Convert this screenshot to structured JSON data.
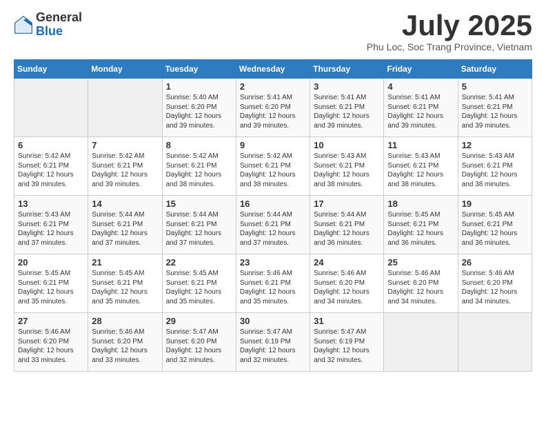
{
  "logo": {
    "general": "General",
    "blue": "Blue"
  },
  "title": {
    "month": "July 2025",
    "location": "Phu Loc, Soc Trang Province, Vietnam"
  },
  "headers": [
    "Sunday",
    "Monday",
    "Tuesday",
    "Wednesday",
    "Thursday",
    "Friday",
    "Saturday"
  ],
  "weeks": [
    [
      {
        "day": "",
        "info": ""
      },
      {
        "day": "",
        "info": ""
      },
      {
        "day": "1",
        "info": "Sunrise: 5:40 AM\nSunset: 6:20 PM\nDaylight: 12 hours and 39 minutes."
      },
      {
        "day": "2",
        "info": "Sunrise: 5:41 AM\nSunset: 6:20 PM\nDaylight: 12 hours and 39 minutes."
      },
      {
        "day": "3",
        "info": "Sunrise: 5:41 AM\nSunset: 6:21 PM\nDaylight: 12 hours and 39 minutes."
      },
      {
        "day": "4",
        "info": "Sunrise: 5:41 AM\nSunset: 6:21 PM\nDaylight: 12 hours and 39 minutes."
      },
      {
        "day": "5",
        "info": "Sunrise: 5:41 AM\nSunset: 6:21 PM\nDaylight: 12 hours and 39 minutes."
      }
    ],
    [
      {
        "day": "6",
        "info": "Sunrise: 5:42 AM\nSunset: 6:21 PM\nDaylight: 12 hours and 39 minutes."
      },
      {
        "day": "7",
        "info": "Sunrise: 5:42 AM\nSunset: 6:21 PM\nDaylight: 12 hours and 39 minutes."
      },
      {
        "day": "8",
        "info": "Sunrise: 5:42 AM\nSunset: 6:21 PM\nDaylight: 12 hours and 38 minutes."
      },
      {
        "day": "9",
        "info": "Sunrise: 5:42 AM\nSunset: 6:21 PM\nDaylight: 12 hours and 38 minutes."
      },
      {
        "day": "10",
        "info": "Sunrise: 5:43 AM\nSunset: 6:21 PM\nDaylight: 12 hours and 38 minutes."
      },
      {
        "day": "11",
        "info": "Sunrise: 5:43 AM\nSunset: 6:21 PM\nDaylight: 12 hours and 38 minutes."
      },
      {
        "day": "12",
        "info": "Sunrise: 5:43 AM\nSunset: 6:21 PM\nDaylight: 12 hours and 38 minutes."
      }
    ],
    [
      {
        "day": "13",
        "info": "Sunrise: 5:43 AM\nSunset: 6:21 PM\nDaylight: 12 hours and 37 minutes."
      },
      {
        "day": "14",
        "info": "Sunrise: 5:44 AM\nSunset: 6:21 PM\nDaylight: 12 hours and 37 minutes."
      },
      {
        "day": "15",
        "info": "Sunrise: 5:44 AM\nSunset: 6:21 PM\nDaylight: 12 hours and 37 minutes."
      },
      {
        "day": "16",
        "info": "Sunrise: 5:44 AM\nSunset: 6:21 PM\nDaylight: 12 hours and 37 minutes."
      },
      {
        "day": "17",
        "info": "Sunrise: 5:44 AM\nSunset: 6:21 PM\nDaylight: 12 hours and 36 minutes."
      },
      {
        "day": "18",
        "info": "Sunrise: 5:45 AM\nSunset: 6:21 PM\nDaylight: 12 hours and 36 minutes."
      },
      {
        "day": "19",
        "info": "Sunrise: 5:45 AM\nSunset: 6:21 PM\nDaylight: 12 hours and 36 minutes."
      }
    ],
    [
      {
        "day": "20",
        "info": "Sunrise: 5:45 AM\nSunset: 6:21 PM\nDaylight: 12 hours and 35 minutes."
      },
      {
        "day": "21",
        "info": "Sunrise: 5:45 AM\nSunset: 6:21 PM\nDaylight: 12 hours and 35 minutes."
      },
      {
        "day": "22",
        "info": "Sunrise: 5:45 AM\nSunset: 6:21 PM\nDaylight: 12 hours and 35 minutes."
      },
      {
        "day": "23",
        "info": "Sunrise: 5:46 AM\nSunset: 6:21 PM\nDaylight: 12 hours and 35 minutes."
      },
      {
        "day": "24",
        "info": "Sunrise: 5:46 AM\nSunset: 6:20 PM\nDaylight: 12 hours and 34 minutes."
      },
      {
        "day": "25",
        "info": "Sunrise: 5:46 AM\nSunset: 6:20 PM\nDaylight: 12 hours and 34 minutes."
      },
      {
        "day": "26",
        "info": "Sunrise: 5:46 AM\nSunset: 6:20 PM\nDaylight: 12 hours and 34 minutes."
      }
    ],
    [
      {
        "day": "27",
        "info": "Sunrise: 5:46 AM\nSunset: 6:20 PM\nDaylight: 12 hours and 33 minutes."
      },
      {
        "day": "28",
        "info": "Sunrise: 5:46 AM\nSunset: 6:20 PM\nDaylight: 12 hours and 33 minutes."
      },
      {
        "day": "29",
        "info": "Sunrise: 5:47 AM\nSunset: 6:20 PM\nDaylight: 12 hours and 32 minutes."
      },
      {
        "day": "30",
        "info": "Sunrise: 5:47 AM\nSunset: 6:19 PM\nDaylight: 12 hours and 32 minutes."
      },
      {
        "day": "31",
        "info": "Sunrise: 5:47 AM\nSunset: 6:19 PM\nDaylight: 12 hours and 32 minutes."
      },
      {
        "day": "",
        "info": ""
      },
      {
        "day": "",
        "info": ""
      }
    ]
  ],
  "emptyWeekRows": [
    [
      0,
      1
    ],
    [
      4,
      5
    ],
    [
      4,
      6
    ]
  ]
}
